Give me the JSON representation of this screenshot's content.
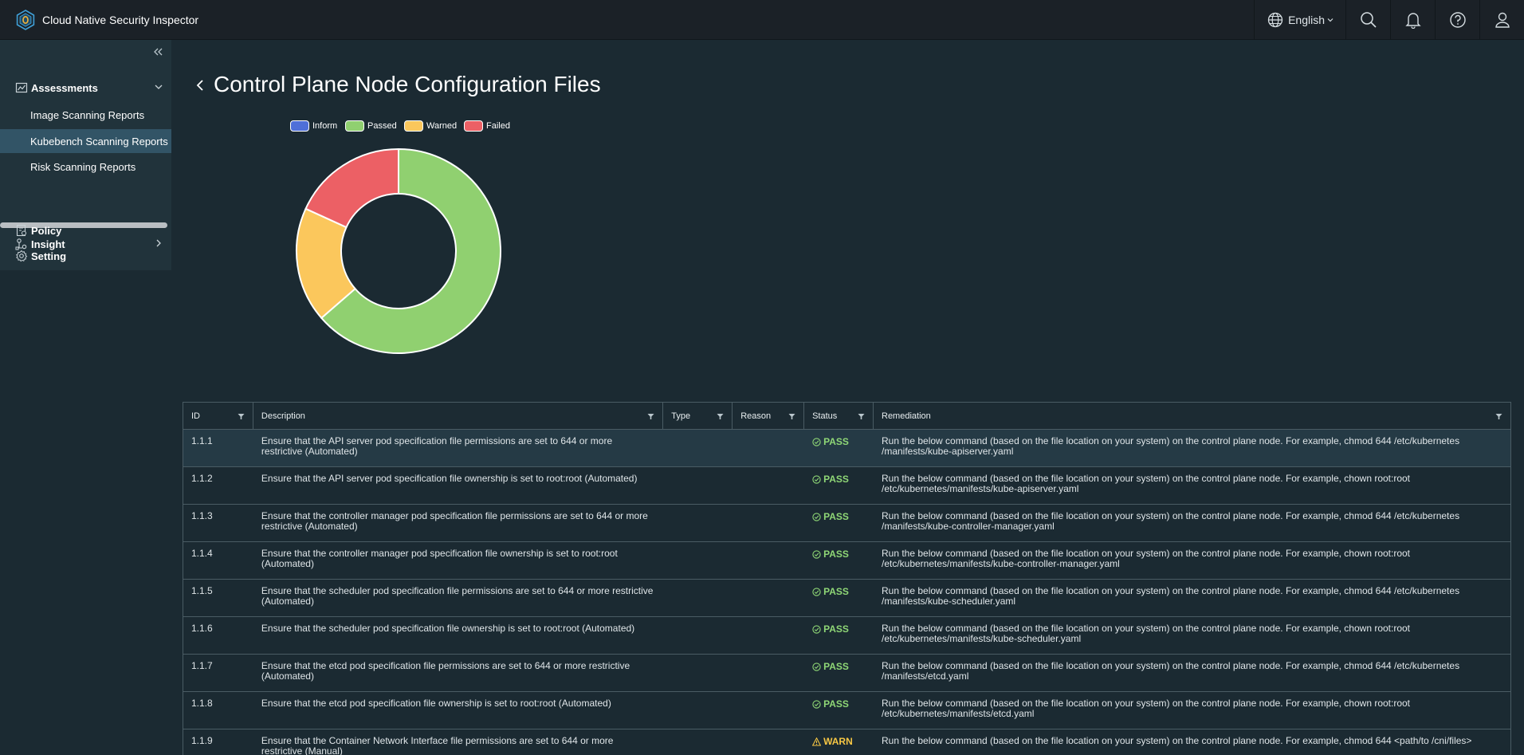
{
  "header": {
    "app_title": "Cloud Native Security Inspector",
    "language": "English",
    "icons": [
      "globe-icon",
      "search-icon",
      "bell-icon",
      "help-icon",
      "user-icon"
    ]
  },
  "sidebar": {
    "groups": [
      {
        "label": "Assessments",
        "icon": "chart-icon",
        "expanded": true,
        "items": [
          {
            "label": "Image Scanning Reports",
            "active": false
          },
          {
            "label": "Kubebench Scanning Reports",
            "active": true
          },
          {
            "label": "Risk Scanning Reports",
            "active": false
          }
        ]
      },
      {
        "label": "Insight",
        "icon": "insight-icon"
      },
      {
        "label": "Policy",
        "icon": "policy-icon"
      },
      {
        "label": "Setting",
        "icon": "gear-icon"
      }
    ]
  },
  "page": {
    "title": "Control Plane Node Configuration Files"
  },
  "chart_data": {
    "type": "pie",
    "legend": [
      "Inform",
      "Passed",
      "Warned",
      "Failed"
    ],
    "values": [
      0,
      7,
      2,
      2
    ],
    "colors": [
      "#4f6fd8",
      "#90d070",
      "#fbc75c",
      "#ec6065"
    ],
    "legend_position": "top"
  },
  "table": {
    "columns": [
      "ID",
      "Description",
      "Type",
      "Reason",
      "Status",
      "Remediation"
    ],
    "rows": [
      {
        "id": "1.1.1",
        "description": "Ensure that the API server pod specification file permissions are set to 644 or more restrictive (Automated)",
        "type": "",
        "reason": "",
        "status": "PASS",
        "remediation": "Run the below command (based on the file location on your system) on the control plane node. For example, chmod 644 /etc/kubernetes /manifests/kube-apiserver.yaml"
      },
      {
        "id": "1.1.2",
        "description": "Ensure that the API server pod specification file ownership is set to root:root (Automated)",
        "type": "",
        "reason": "",
        "status": "PASS",
        "remediation": "Run the below command (based on the file location on your system) on the control plane node. For example, chown root:root /etc/kubernetes/manifests/kube-apiserver.yaml"
      },
      {
        "id": "1.1.3",
        "description": "Ensure that the controller manager pod specification file permissions are set to 644 or more restrictive (Automated)",
        "type": "",
        "reason": "",
        "status": "PASS",
        "remediation": "Run the below command (based on the file location on your system) on the control plane node. For example, chmod 644 /etc/kubernetes /manifests/kube-controller-manager.yaml"
      },
      {
        "id": "1.1.4",
        "description": "Ensure that the controller manager pod specification file ownership is set to root:root (Automated)",
        "type": "",
        "reason": "",
        "status": "PASS",
        "remediation": "Run the below command (based on the file location on your system) on the control plane node. For example, chown root:root /etc/kubernetes/manifests/kube-controller-manager.yaml"
      },
      {
        "id": "1.1.5",
        "description": "Ensure that the scheduler pod specification file permissions are set to 644 or more restrictive (Automated)",
        "type": "",
        "reason": "",
        "status": "PASS",
        "remediation": "Run the below command (based on the file location on your system) on the control plane node. For example, chmod 644 /etc/kubernetes /manifests/kube-scheduler.yaml"
      },
      {
        "id": "1.1.6",
        "description": "Ensure that the scheduler pod specification file ownership is set to root:root (Automated)",
        "type": "",
        "reason": "",
        "status": "PASS",
        "remediation": "Run the below command (based on the file location on your system) on the control plane node. For example, chown root:root /etc/kubernetes/manifests/kube-scheduler.yaml"
      },
      {
        "id": "1.1.7",
        "description": "Ensure that the etcd pod specification file permissions are set to 644 or more restrictive (Automated)",
        "type": "",
        "reason": "",
        "status": "PASS",
        "remediation": "Run the below command (based on the file location on your system) on the control plane node. For example, chmod 644 /etc/kubernetes /manifests/etcd.yaml"
      },
      {
        "id": "1.1.8",
        "description": "Ensure that the etcd pod specification file ownership is set to root:root (Automated)",
        "type": "",
        "reason": "",
        "status": "PASS",
        "remediation": "Run the below command (based on the file location on your system) on the control plane node. For example, chown root:root /etc/kubernetes/manifests/etcd.yaml"
      },
      {
        "id": "1.1.9",
        "description": "Ensure that the Container Network Interface file permissions are set to 644 or more restrictive (Manual)",
        "type": "",
        "reason": "",
        "status": "WARN",
        "remediation": "Run the below command (based on the file location on your system) on the control plane node. For example, chmod 644 <path/to /cni/files>"
      }
    ]
  }
}
